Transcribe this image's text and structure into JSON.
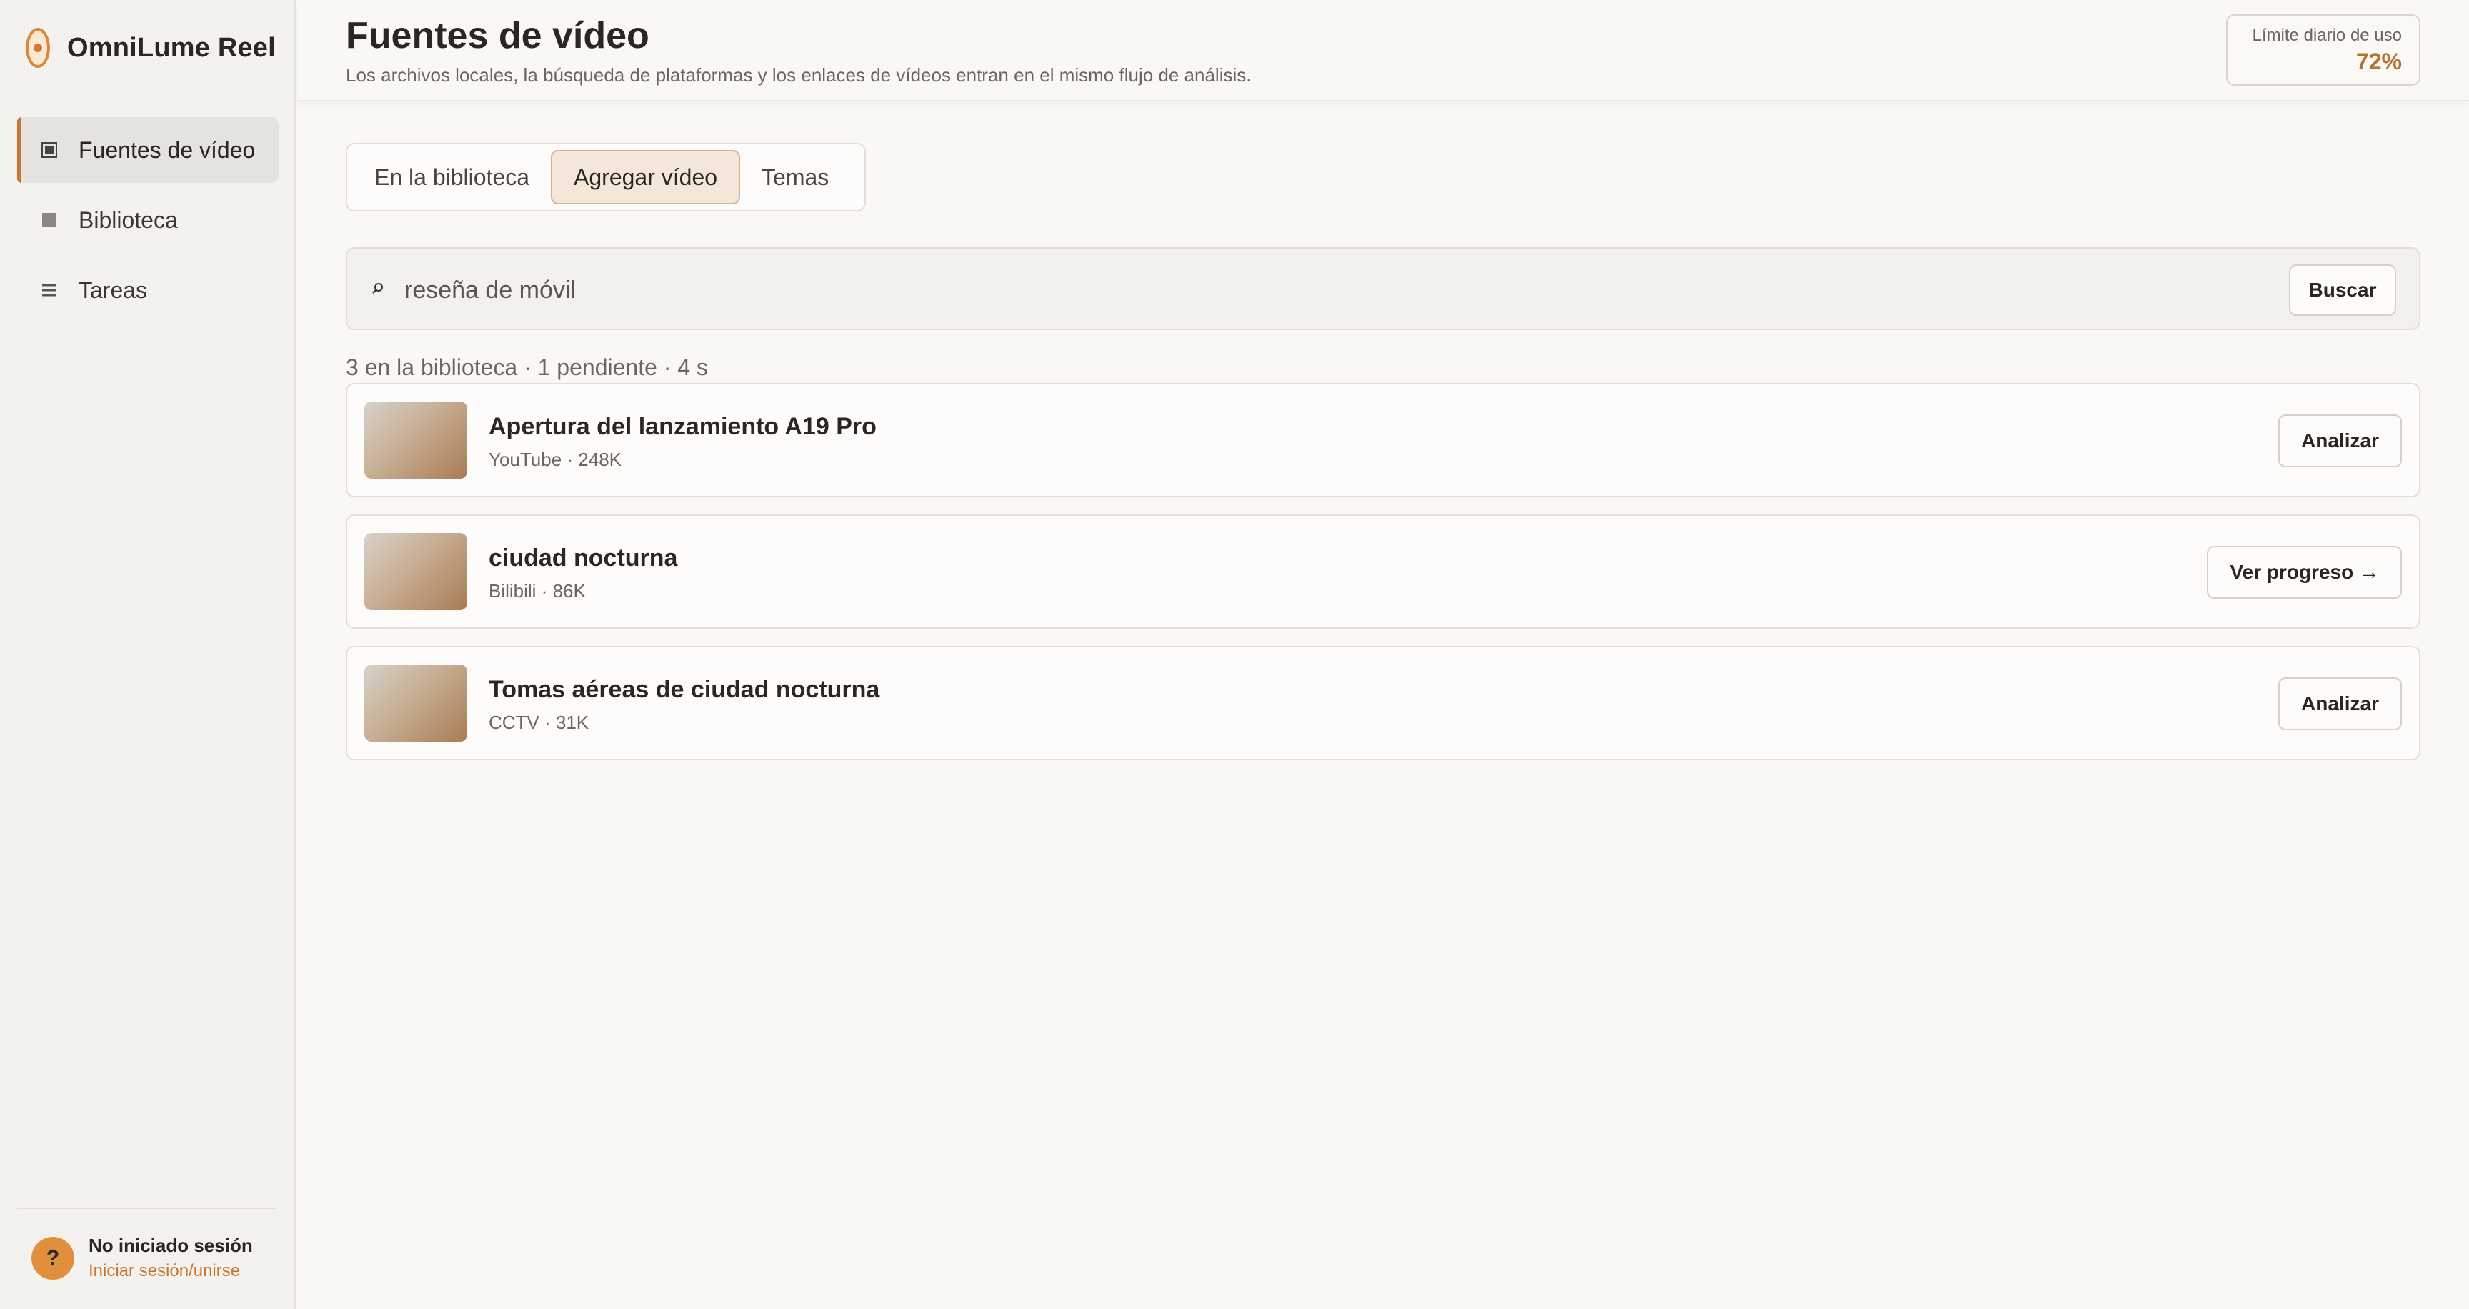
{
  "app": {
    "name": "OmniLume Reel"
  },
  "sidebar": {
    "items": [
      {
        "label": "Fuentes de vídeo",
        "icon": "video-source-icon",
        "active": true
      },
      {
        "label": "Biblioteca",
        "icon": "library-icon",
        "active": false
      },
      {
        "label": "Tareas",
        "icon": "tasks-icon",
        "active": false
      }
    ],
    "user": {
      "avatar_glyph": "?",
      "status": "No iniciado sesión",
      "login_link": "Iniciar sesión/unirse"
    }
  },
  "header": {
    "title": "Fuentes de vídeo",
    "subtitle": "Los archivos locales, la búsqueda de plataformas y los enlaces de vídeos entran en el mismo flujo de análisis.",
    "quota": {
      "label": "Límite diario de uso",
      "value": "72%"
    }
  },
  "tabs": [
    {
      "label": "En la biblioteca",
      "active": false
    },
    {
      "label": "Agregar vídeo",
      "active": true
    },
    {
      "label": "Temas",
      "active": false
    }
  ],
  "search": {
    "value": "reseña de móvil",
    "button_label": "Buscar"
  },
  "summary": "3 en la biblioteca · 1 pendiente · 4 s",
  "results": [
    {
      "title": "Apertura del lanzamiento A19 Pro",
      "meta": "YouTube · 248K",
      "action": "Analizar"
    },
    {
      "title": "ciudad nocturna",
      "meta": "Bilibili · 86K",
      "action": "Ver progreso →"
    },
    {
      "title": "Tomas aéreas de ciudad nocturna",
      "meta": "CCTV · 31K",
      "action": "Analizar"
    }
  ],
  "colors": {
    "accent": "#c8743a",
    "quota_value": "#b5732f",
    "active_tab_bg": "#f4e7da"
  }
}
